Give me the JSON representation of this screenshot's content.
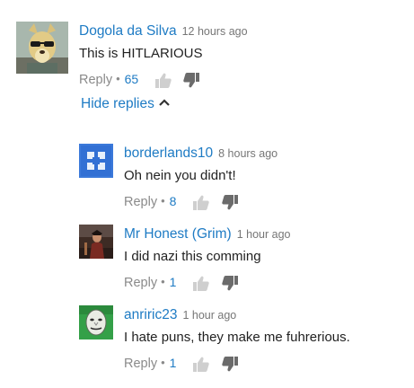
{
  "comments": [
    {
      "author": "Dogola da Silva",
      "time": "12 hours ago",
      "text": "This is HITLARIOUS",
      "reply_label": "Reply",
      "likes": "65",
      "avatar_icon": "dog-mask-avatar"
    }
  ],
  "hide_replies_label": "Hide replies",
  "replies": [
    {
      "author": "borderlands10",
      "time": "8 hours ago",
      "text": "Oh nein you didn't!",
      "reply_label": "Reply",
      "likes": "8",
      "avatar_icon": "blue-square-avatar"
    },
    {
      "author": "Mr Honest (Grim)",
      "time": "1 hour ago",
      "text": "I did nazi this comming",
      "reply_label": "Reply",
      "likes": "1",
      "avatar_icon": "dark-figure-avatar"
    },
    {
      "author": "anriric23",
      "time": "1 hour ago",
      "text": "I hate puns, they make me fuhrerious.",
      "reply_label": "Reply",
      "likes": "1",
      "avatar_icon": "green-face-avatar"
    }
  ],
  "colors": {
    "link_blue": "#1e7bc4",
    "muted_gray": "#8a8a8a",
    "text": "#222222"
  }
}
